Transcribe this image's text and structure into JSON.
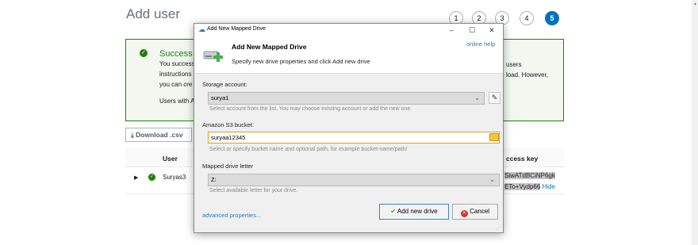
{
  "page": {
    "title": "Add user",
    "steps": [
      "1",
      "2",
      "3",
      "4",
      "5"
    ],
    "active_step": "5",
    "success": {
      "title": "Success",
      "lines_left": [
        "You success",
        "instructions",
        "you can cre"
      ],
      "users_line": "Users with A",
      "lines_right": [
        "users",
        "load. However,"
      ]
    },
    "download_label": "Download .csv",
    "table": {
      "col_user": "User",
      "col_access_key": "ccess key",
      "rows": [
        {
          "user": "Suryas3",
          "key_line1": "SiwATdBCiNP6gk",
          "key_line2": "ETo+Vydp66",
          "hide_label": "Hide"
        }
      ]
    }
  },
  "dialog": {
    "window_title": "Add New Mapped Drive",
    "header_title": "Add New Mapped Drive",
    "header_subtitle": "Specify new drive properties and click Add new drive",
    "online_help": "online help",
    "storage_label": "Storage account:",
    "storage_value": "surya1",
    "storage_hint": "Select account from the list. You may choose existing account or add the new one.",
    "bucket_label": "Amazon S3 bucket:",
    "bucket_value": "suryaa12345",
    "bucket_hint": "Select or specify bucket name and optional path, for example bucket-name/path/",
    "letter_label": "Mapped drive letter",
    "letter_value": "Z:",
    "letter_hint": "Select available letter for your drive.",
    "advanced_link": "advanced properties...",
    "add_button": "Add new drive",
    "cancel_button": "Cancel",
    "minimize": "–",
    "maximize": "☐",
    "close": "✕"
  },
  "colors": {
    "accent": "#0073bb",
    "success": "#1d8102",
    "link": "#2a7ab8"
  }
}
